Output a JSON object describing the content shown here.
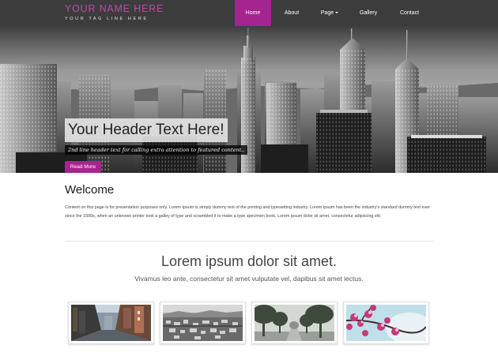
{
  "header": {
    "brand_name": "YOUR NAME HERE",
    "tagline": "YOUR TAG LINE HERE",
    "accent_color": "#a6248f",
    "nav": [
      {
        "label": "Home",
        "active": true
      },
      {
        "label": "About",
        "active": false
      },
      {
        "label": "Page",
        "active": false,
        "has_dropdown": true
      },
      {
        "label": "Gallery",
        "active": false
      },
      {
        "label": "Contact",
        "active": false
      }
    ]
  },
  "hero": {
    "title": "Your Header Text Here!",
    "subtitle": "2nd line header text for calling extra attention to featured content..",
    "button_label": "Read More"
  },
  "welcome": {
    "title": "Welcome",
    "text": "Content on this page is for presentation purposes only. Lorem Ipsum is simply dummy text of the printing and typesetting industry. Lorem Ipsum has been the industry's standard dummy text ever since the 1500s, when an unknown printer took a galley of type and scrambled it to make a type specimen book. Lorem ipsum dolor sit amet, consectetur adipiscing elit."
  },
  "lorem": {
    "title": "Lorem ipsum dolor sit amet.",
    "subtitle": "Vivamus leo ante, consectetur sit amet vulputate vel, dapibus sit amet lectus."
  },
  "gallery": [
    {
      "name": "city-street-photo"
    },
    {
      "name": "town-aerial-photo"
    },
    {
      "name": "foggy-trees-photo"
    },
    {
      "name": "pink-blossoms-photo"
    }
  ]
}
